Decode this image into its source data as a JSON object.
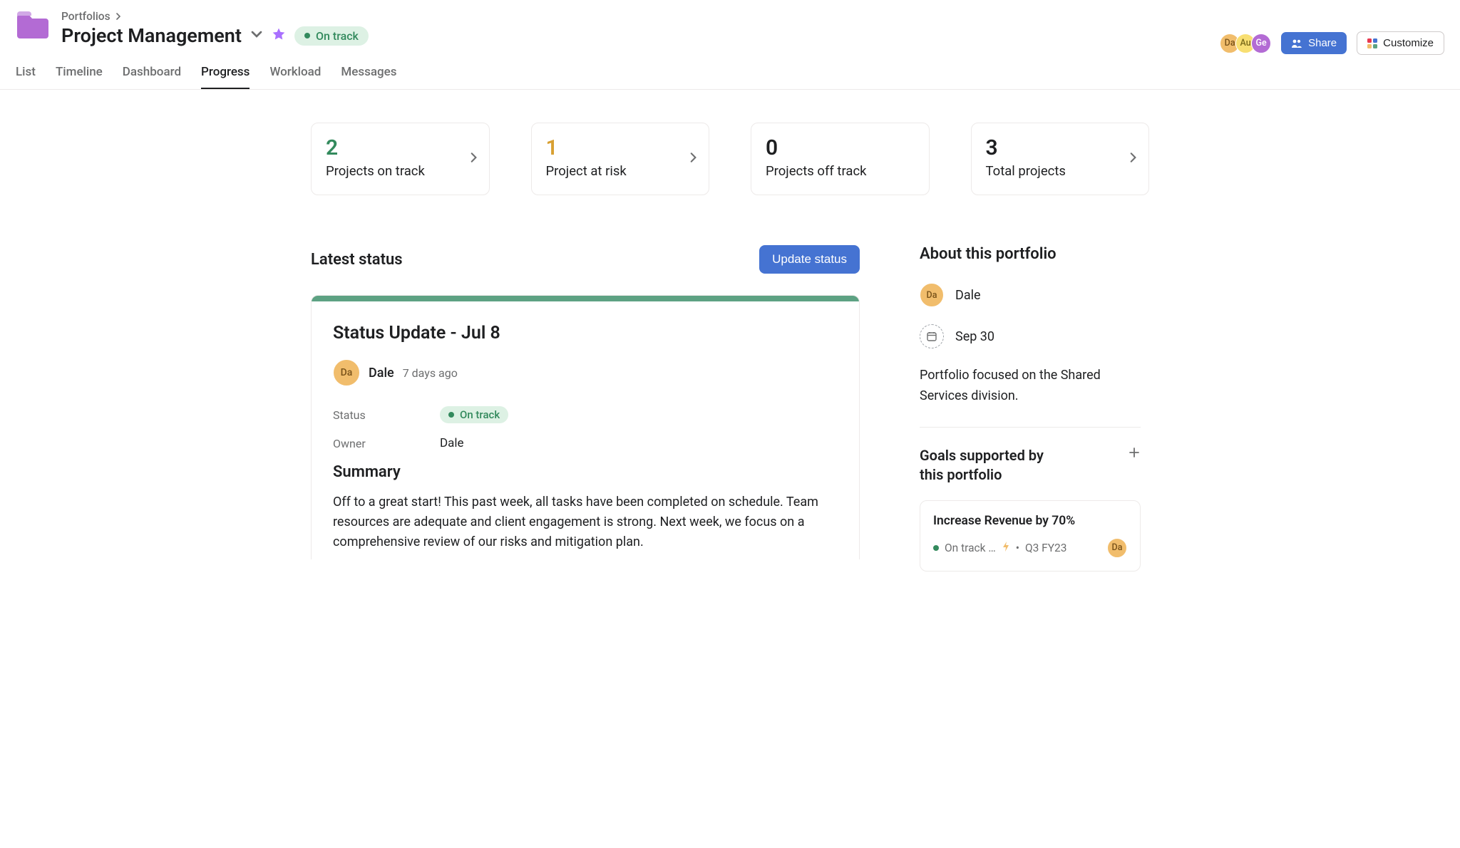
{
  "breadcrumb": {
    "root": "Portfolios"
  },
  "pageTitle": "Project Management",
  "statusPill": "On track",
  "headerAvatars": [
    {
      "initials": "Da",
      "cls": "av-orange"
    },
    {
      "initials": "Au",
      "cls": "av-yellow"
    },
    {
      "initials": "Ge",
      "cls": "av-purple"
    }
  ],
  "shareBtn": "Share",
  "customizeBtn": "Customize",
  "tabs": {
    "list": "List",
    "timeline": "Timeline",
    "dashboard": "Dashboard",
    "progress": "Progress",
    "workload": "Workload",
    "messages": "Messages"
  },
  "stats": [
    {
      "num": "2",
      "label": "Projects on track",
      "numCls": "stat-green",
      "arrow": true
    },
    {
      "num": "1",
      "label": "Project at risk",
      "numCls": "stat-yellow",
      "arrow": true
    },
    {
      "num": "0",
      "label": "Projects off track",
      "numCls": "",
      "arrow": false
    },
    {
      "num": "3",
      "label": "Total projects",
      "numCls": "",
      "arrow": true
    }
  ],
  "latestStatusTitle": "Latest status",
  "updateStatusBtn": "Update status",
  "status": {
    "title": "Status Update - Jul 8",
    "authorInitials": "Da",
    "authorName": "Dale",
    "time": "7 days ago",
    "statusLabel": "Status",
    "statusValue": "On track",
    "ownerLabel": "Owner",
    "ownerValue": "Dale",
    "summaryHeading": "Summary",
    "summaryText": "Off to a great start! This past week, all tasks have been completed on schedule. Team resources are adequate and client engagement is strong. Next week, we focus on a comprehensive review of our risks and mitigation plan."
  },
  "about": {
    "title": "About this portfolio",
    "ownerInitials": "Da",
    "ownerName": "Dale",
    "date": "Sep 30",
    "description": "Portfolio focused on the Shared Services division."
  },
  "goals": {
    "title": "Goals supported by this portfolio",
    "item": {
      "name": "Increase Revenue by 70%",
      "status": "On track …",
      "period": "Q3 FY23",
      "ownerInitials": "Da"
    }
  }
}
